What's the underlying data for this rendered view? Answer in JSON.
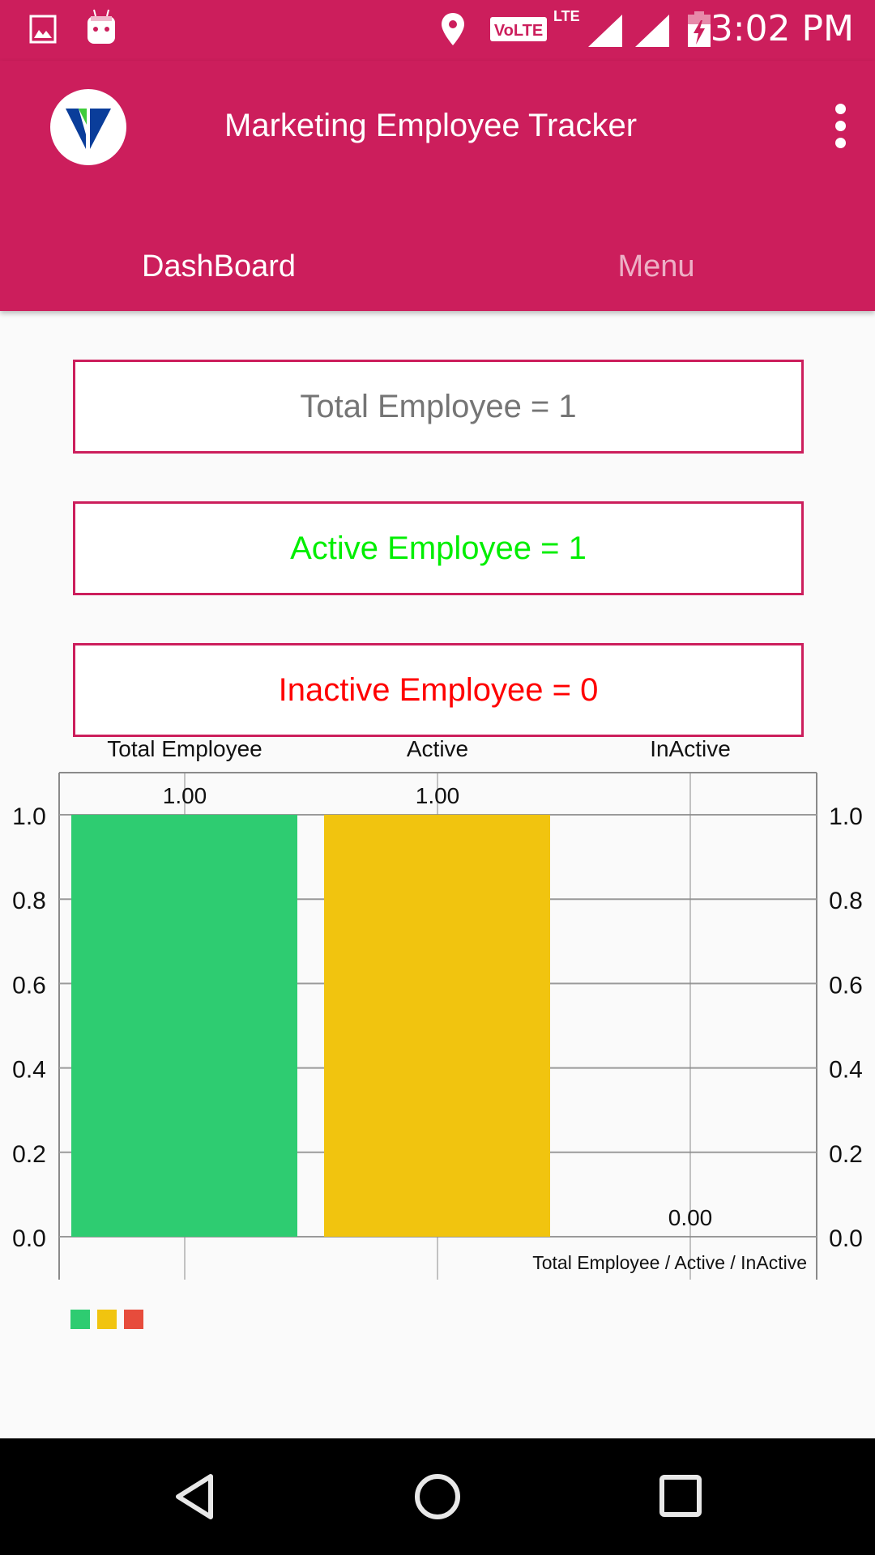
{
  "status_bar": {
    "time": "3:02 PM",
    "icons": [
      "image-notification-icon",
      "android-notification-icon",
      "location-icon",
      "volte-icon",
      "lte-icon",
      "signal-icon",
      "signal-icon",
      "battery-charging-icon"
    ],
    "volte_label": "VoLTE",
    "lte_label": "LTE"
  },
  "app_bar": {
    "title": "Marketing Employee Tracker",
    "logo": "app-logo",
    "overflow_icon": "more-vert-icon"
  },
  "tabs": [
    {
      "label": "DashBoard",
      "active": true
    },
    {
      "label": "Menu",
      "active": false
    }
  ],
  "stats": {
    "total": "Total Employee = 1",
    "active": "Active Employee =  1",
    "inactive": "Inactive Employee =  0"
  },
  "colors": {
    "brand": "#cc1e5c",
    "active_text": "#00ee00",
    "inactive_text": "#ff0000",
    "total_text": "#757575"
  },
  "chart_data": {
    "type": "bar",
    "categories": [
      "Total Employee",
      "Active",
      "InActive"
    ],
    "values": [
      1.0,
      1.0,
      0.0
    ],
    "value_labels": [
      "1.00",
      "1.00",
      "0.00"
    ],
    "colors": [
      "#2ecc71",
      "#f1c40f",
      "#e74c3c"
    ],
    "ylim": [
      0,
      1.0
    ],
    "y_ticks": [
      "0.0",
      "0.2",
      "0.4",
      "0.6",
      "0.8",
      "1.0"
    ],
    "y_axis_left": true,
    "y_axis_right": true,
    "grid": true,
    "description": "Total Employee /  Active  /  InActive",
    "legend": {
      "placement": "bottom-left",
      "entries": [
        "",
        "",
        ""
      ]
    }
  },
  "nav_bar": {
    "buttons": [
      "back",
      "home",
      "recents"
    ]
  }
}
